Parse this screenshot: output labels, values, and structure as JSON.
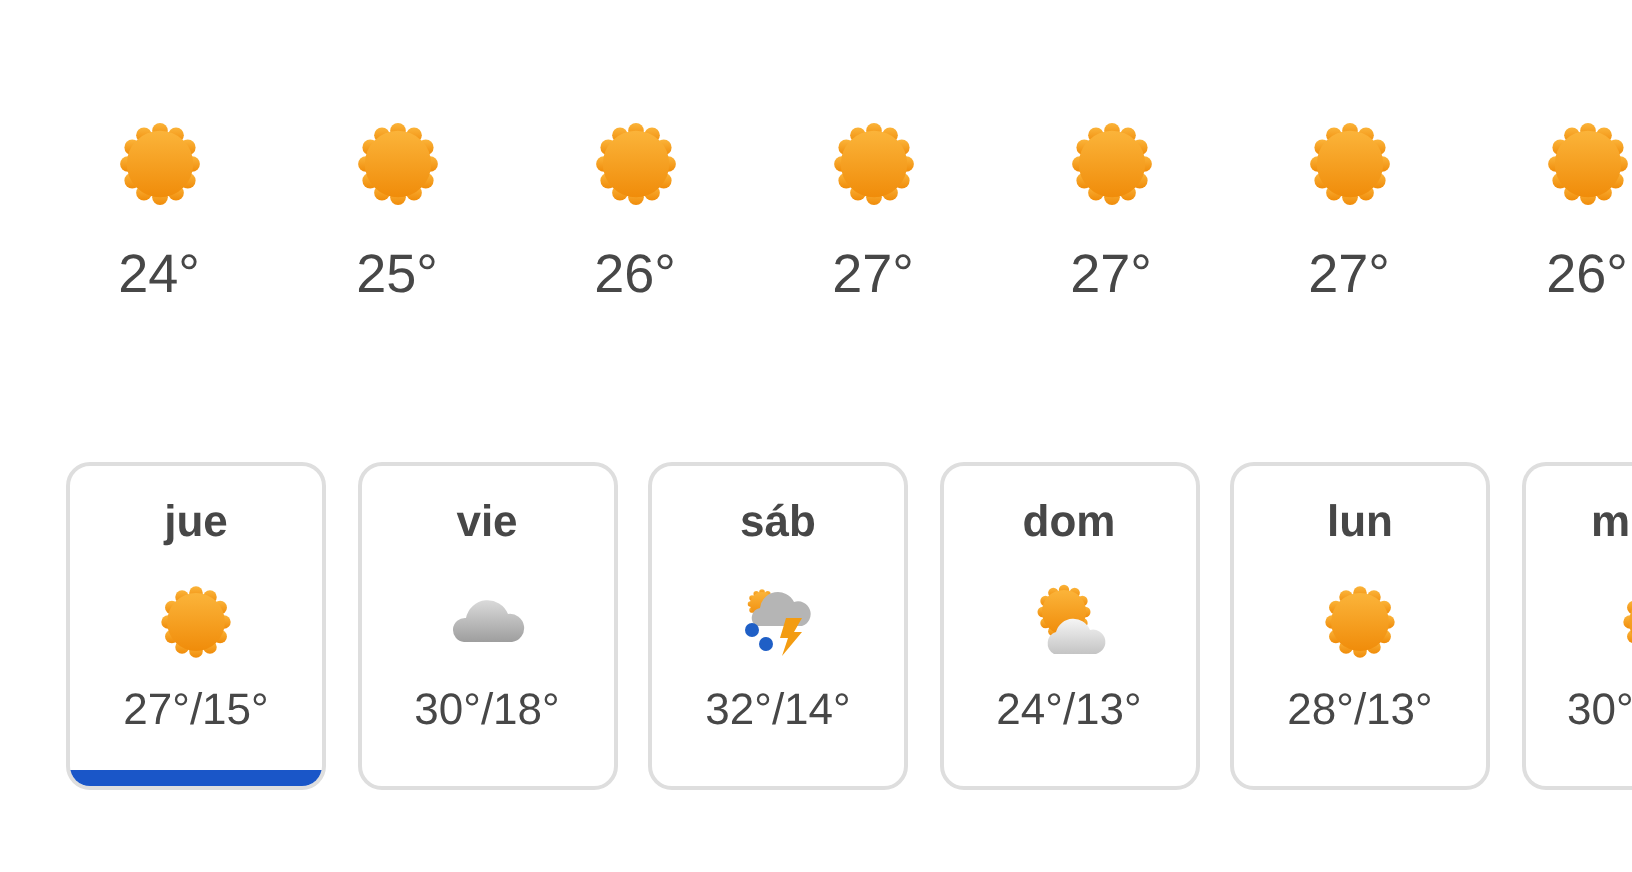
{
  "hourly": [
    {
      "temp": "24°"
    },
    {
      "temp": "25°"
    },
    {
      "temp": "26°"
    },
    {
      "temp": "27°"
    },
    {
      "temp": "27°"
    },
    {
      "temp": "27°"
    },
    {
      "temp": "26°"
    }
  ],
  "daily": [
    {
      "day": "jue",
      "kind": "sun",
      "temps": "27°/15°",
      "selected": true,
      "cut_off": false
    },
    {
      "day": "vie",
      "kind": "cloud",
      "temps": "30°/18°",
      "selected": false,
      "cut_off": false
    },
    {
      "day": "sáb",
      "kind": "storm",
      "temps": "32°/14°",
      "selected": false,
      "cut_off": false
    },
    {
      "day": "dom",
      "kind": "partly",
      "temps": "24°/13°",
      "selected": false,
      "cut_off": false
    },
    {
      "day": "lun",
      "kind": "sun",
      "temps": "28°/13°",
      "selected": false,
      "cut_off": false
    },
    {
      "day": "m",
      "kind": "sun",
      "temps": "30°",
      "selected": false,
      "cut_off": true
    }
  ]
}
